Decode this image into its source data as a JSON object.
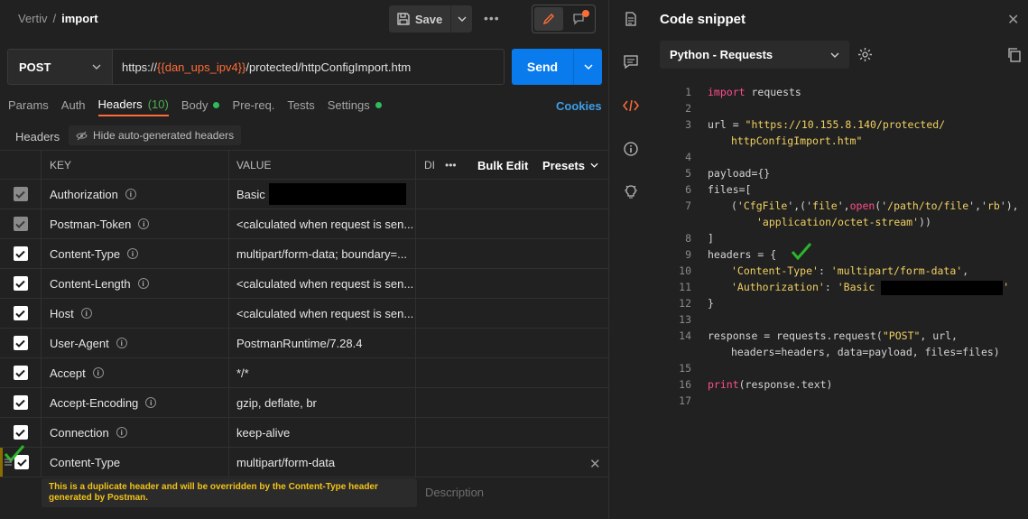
{
  "topbar": {
    "workspace": "Vertiv",
    "separator": "/",
    "request_name": "import",
    "save_label": "Save",
    "more_label": "•••"
  },
  "request": {
    "method": "POST",
    "url_prefix": "https://",
    "url_variable": "{{dan_ups_ipv4}}",
    "url_suffix": "/protected/httpConfigImport.htm",
    "send_label": "Send"
  },
  "tabs": {
    "params": "Params",
    "auth": "Auth",
    "headers": "Headers",
    "headers_count": "(10)",
    "body": "Body",
    "prereq": "Pre-req.",
    "tests": "Tests",
    "settings": "Settings",
    "cookies": "Cookies"
  },
  "subheader": {
    "label": "Headers",
    "hide_btn": "Hide auto-generated headers"
  },
  "grid": {
    "col_key": "KEY",
    "col_value": "VALUE",
    "col_desc": "DI",
    "more": "•••",
    "bulk_edit": "Bulk Edit",
    "presets": "Presets",
    "rows": [
      {
        "key": "Authorization",
        "value": "Basic"
      },
      {
        "key": "Postman-Token",
        "value": "<calculated when request is sen..."
      },
      {
        "key": "Content-Type",
        "value": "multipart/form-data; boundary=..."
      },
      {
        "key": "Content-Length",
        "value": "<calculated when request is sen..."
      },
      {
        "key": "Host",
        "value": "<calculated when request is sen..."
      },
      {
        "key": "User-Agent",
        "value": "PostmanRuntime/7.28.4"
      },
      {
        "key": "Accept",
        "value": "*/*"
      },
      {
        "key": "Accept-Encoding",
        "value": "gzip, deflate, br"
      },
      {
        "key": "Connection",
        "value": "keep-alive"
      },
      {
        "key": "Content-Type",
        "value": "multipart/form-data"
      }
    ],
    "tooltip_line1": "This is a duplicate header and will be overridden by the Content-Type header",
    "tooltip_line2": "generated by Postman.",
    "desc_placeholder": "Description"
  },
  "snippet": {
    "title": "Code snippet",
    "language": "Python - Requests",
    "lines": [
      "1",
      "2",
      "3",
      "",
      "4",
      "5",
      "6",
      "7",
      "",
      "8",
      "9",
      "10",
      "11",
      "12",
      "13",
      "14",
      "",
      "15",
      "16",
      "17"
    ],
    "code": {
      "l1_kw": "import",
      "l1_rest": " requests",
      "l3_a": "url = ",
      "l3_str": "\"https://10.155.8.140/protected/",
      "l3b_str": "httpConfigImport.htm\"",
      "l5": "payload={}",
      "l6": "files=[",
      "l7_a": "('",
      "l7_s1": "CfgFile",
      "l7_b": "',('",
      "l7_s2": "file",
      "l7_c": "',",
      "l7_fn": "open",
      "l7_d": "('",
      "l7_s3": "/path/to/file",
      "l7_e": "','",
      "l7_s4": "rb",
      "l7_f": "'),",
      "l7b_str": "'application/octet-stream'",
      "l7b_rest": "))",
      "l8": "]",
      "l9": "headers = {",
      "l10_k": "'Content-Type'",
      "l10_m": ": ",
      "l10_v": "'multipart/form-data'",
      "l10_e": ",",
      "l11_k": "'Authorization'",
      "l11_m": ": ",
      "l11_v": "'Basic ",
      "l11_e": "'",
      "l12": "}",
      "l14_a": "response = requests.request(",
      "l14_s": "\"POST\"",
      "l14_b": ", url,",
      "l14b": "headers=headers, data=payload, files=files)",
      "l16_fn": "print",
      "l16_rest": "(response.text)"
    }
  },
  "colors": {
    "accent": "#ff6c37",
    "send": "#097bed",
    "link": "#3d9ee8",
    "check_annotation": "#2bb52b",
    "tooltip_text": "#f2c318"
  }
}
